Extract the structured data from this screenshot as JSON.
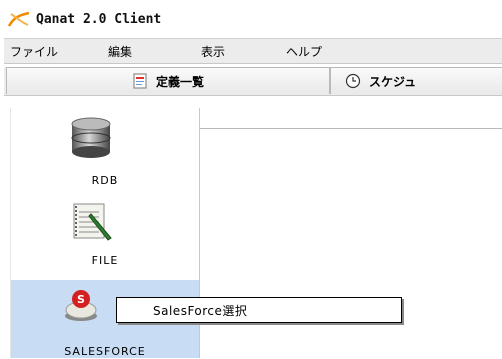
{
  "window": {
    "title": "Qanat 2.0 Client"
  },
  "menu": {
    "items": [
      "ファイル",
      "編集",
      "表示",
      "ヘルプ"
    ]
  },
  "tabs": [
    {
      "label": "定義一覧",
      "icon": "document-icon"
    },
    {
      "label": "スケジュ",
      "icon": "clock-icon"
    }
  ],
  "sidebar": {
    "items": [
      {
        "label": "RDB",
        "icon": "database-icon"
      },
      {
        "label": "FILE",
        "icon": "notepad-icon"
      },
      {
        "label": "SALESFORCE",
        "icon": "salesforce-icon",
        "selected": true
      }
    ]
  },
  "tooltip": {
    "text": "SalesForce選択"
  },
  "colors": {
    "selected_bg": "#c8dcf3",
    "menubar_bg": "#ececec",
    "accent_orange": "#f08a00"
  }
}
